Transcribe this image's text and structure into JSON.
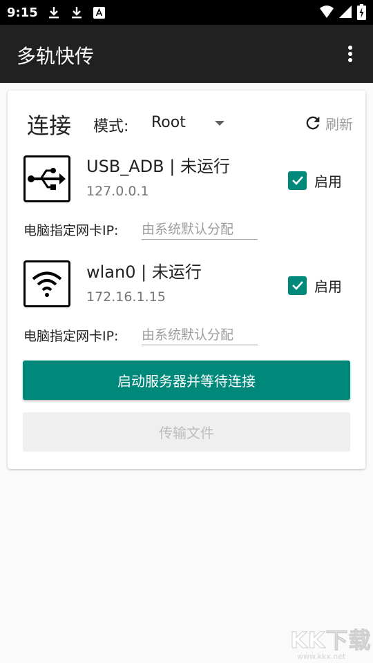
{
  "status_bar": {
    "time": "9:15",
    "left_icons": [
      "download-icon",
      "download-icon",
      "font-a-icon"
    ],
    "right_icons": [
      "signal-wifi-icon",
      "signal-cell-icon",
      "battery-charging-icon"
    ]
  },
  "app_bar": {
    "title": "多轨快传",
    "menu_icon": "more-vert-icon"
  },
  "connection": {
    "title": "连接",
    "mode_label": "模式:",
    "mode_value": "Root",
    "refresh_label": "刷新"
  },
  "devices": [
    {
      "icon": "usb-icon",
      "name": "USB_ADB | 未运行",
      "ip": "127.0.0.1",
      "enabled_label": "启用",
      "enabled": true,
      "nic_label": "电脑指定网卡IP:",
      "nic_placeholder": "由系统默认分配"
    },
    {
      "icon": "wifi-icon",
      "name": "wlan0 | 未运行",
      "ip": "172.16.1.15",
      "enabled_label": "启用",
      "enabled": true,
      "nic_label": "电脑指定网卡IP:",
      "nic_placeholder": "由系统默认分配"
    }
  ],
  "buttons": {
    "start_server": "启动服务器并等待连接",
    "transfer_files": "传输文件"
  },
  "watermark": {
    "main": "KK下载",
    "url": "www.kkx.net"
  },
  "colors": {
    "accent": "#00897b",
    "app_bar": "#212121",
    "status_bar": "#000000"
  }
}
